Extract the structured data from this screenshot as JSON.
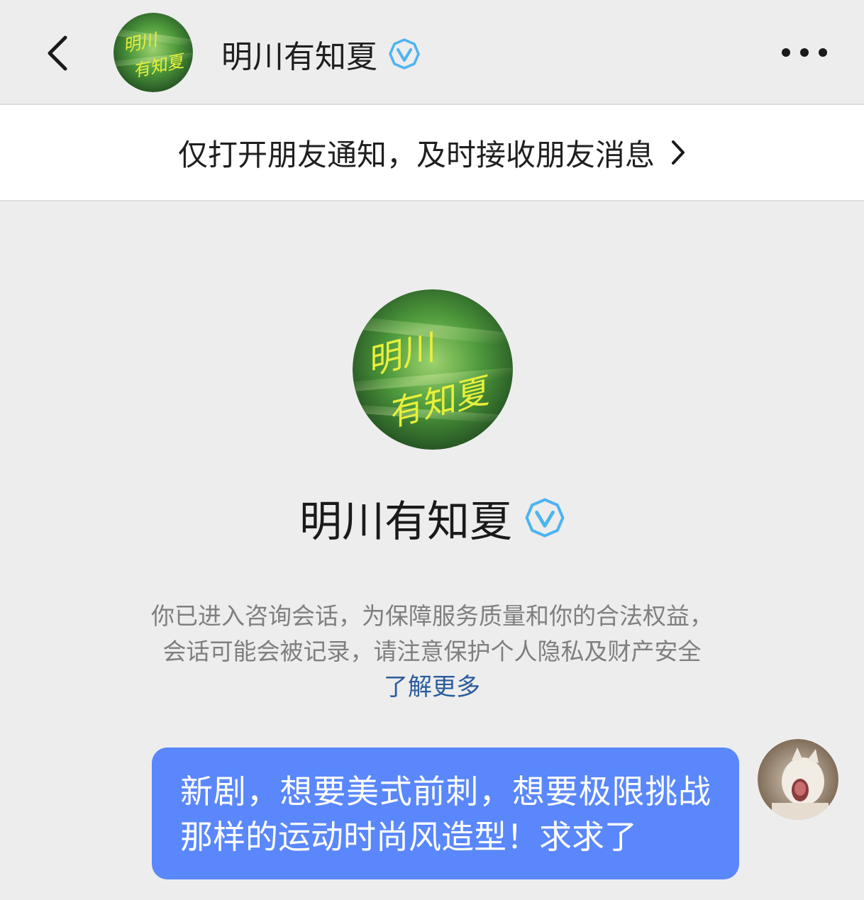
{
  "header": {
    "title": "明川有知夏",
    "back_icon": "chevron-left-icon",
    "more_icon": "more-dots-icon",
    "verified_icon": "blue-v-verified-icon",
    "avatar_text_line1": "明川",
    "avatar_text_line2": "有知夏"
  },
  "notice_bar": {
    "text": "仅打开朋友通知，及时接收朋友消息",
    "arrow_icon": "chevron-right-icon"
  },
  "profile": {
    "name": "明川有知夏",
    "avatar_text_line1": "明川",
    "avatar_text_line2": "有知夏"
  },
  "disclaimer": {
    "line1": "你已进入咨询会话，为保障服务质量和你的合法权益，",
    "line2": "会话可能会被记录，请注意保护个人隐私及财产安全",
    "link": "了解更多"
  },
  "messages": [
    {
      "from": "me",
      "text": "新剧，想要美式前刺，想要极限挑战那样的运动时尚风造型！求求了"
    }
  ],
  "colors": {
    "background": "#ededed",
    "bubble": "#5a87fb",
    "link": "#2b5c9c",
    "verified": "#4db4f0",
    "avatar_text": "#e8f03a"
  }
}
